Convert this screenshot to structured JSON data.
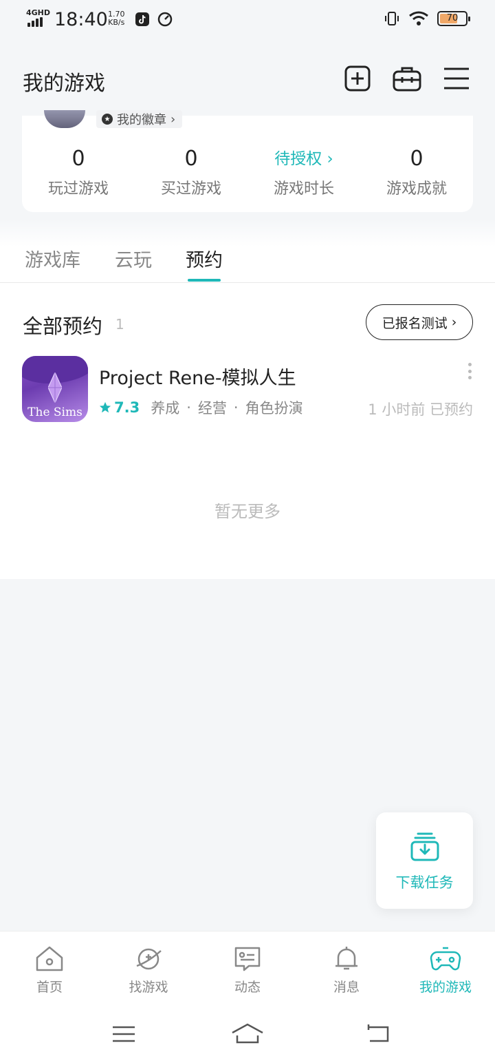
{
  "status_bar": {
    "network": "4GHD",
    "time": "18:40",
    "speed_value": "1.70",
    "speed_unit": "KB/s",
    "battery": "70"
  },
  "header": {
    "title": "我的游戏"
  },
  "profile": {
    "badge_label": "我的徽章"
  },
  "stats": [
    {
      "value": "0",
      "label": "玩过游戏"
    },
    {
      "value": "0",
      "label": "买过游戏"
    },
    {
      "value": "待授权",
      "label": "游戏时长"
    },
    {
      "value": "0",
      "label": "游戏成就"
    }
  ],
  "tabs": [
    {
      "label": "游戏库"
    },
    {
      "label": "云玩"
    },
    {
      "label": "预约"
    }
  ],
  "reservations": {
    "title": "全部预约",
    "count": "1",
    "signed_test_button": "已报名测试",
    "games": [
      {
        "icon_text": "The Sims",
        "name": "Project Rene-模拟人生",
        "rating": "7.3",
        "tags": [
          "养成",
          "经营",
          "角色扮演"
        ],
        "status": "1 小时前 已预约"
      }
    ],
    "empty_more": "暂无更多"
  },
  "fab": {
    "label": "下载任务"
  },
  "bottom_nav": [
    {
      "label": "首页",
      "icon": "home-icon"
    },
    {
      "label": "找游戏",
      "icon": "planet-icon"
    },
    {
      "label": "动态",
      "icon": "chat-icon"
    },
    {
      "label": "消息",
      "icon": "bell-icon"
    },
    {
      "label": "我的游戏",
      "icon": "gamepad-icon",
      "active": true
    }
  ],
  "colors": {
    "accent": "#1fb8b8",
    "background": "#f4f6f8"
  }
}
